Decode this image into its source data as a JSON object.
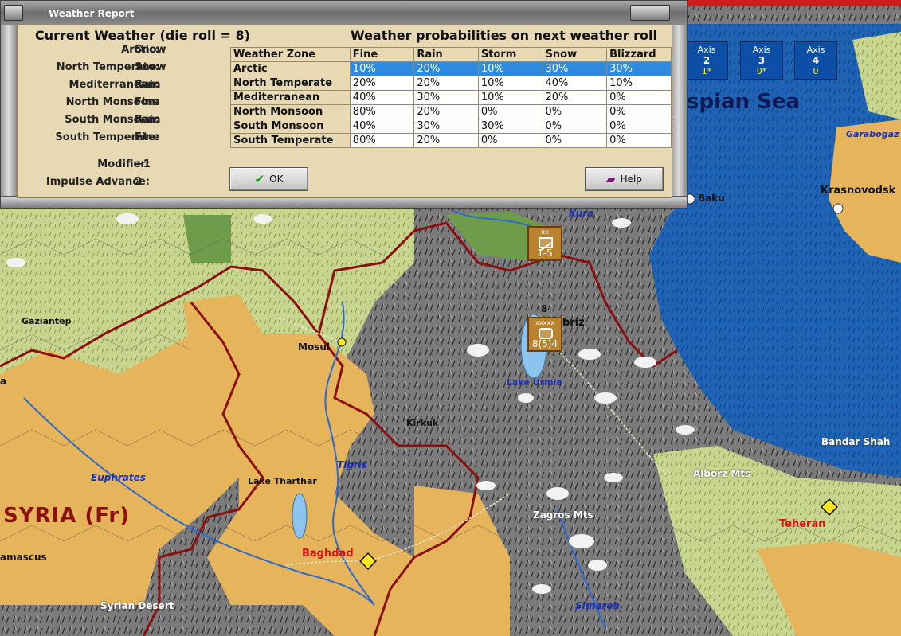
{
  "dialog": {
    "title": "Weather Report",
    "current_heading": "Current Weather (die roll = 8)",
    "prob_heading": "Weather probabilities on next weather roll",
    "current": [
      {
        "zone": "Arctic:",
        "weather": "Snow"
      },
      {
        "zone": "North Temperate:",
        "weather": "Snow"
      },
      {
        "zone": "Mediterranean:",
        "weather": "Rain"
      },
      {
        "zone": "North Monsoon:",
        "weather": "Fine"
      },
      {
        "zone": "South Monsoon:",
        "weather": "Rain"
      },
      {
        "zone": "South Temperate:",
        "weather": "Fine"
      }
    ],
    "modifier_label": "Modifier:",
    "modifier_value": "+1",
    "impulse_label": "Impulse Advance:",
    "impulse_value": "2",
    "table": {
      "headers": [
        "Weather Zone",
        "Fine",
        "Rain",
        "Storm",
        "Snow",
        "Blizzard"
      ],
      "rows": [
        [
          "Arctic",
          "10%",
          "20%",
          "10%",
          "30%",
          "30%"
        ],
        [
          "North Temperate",
          "20%",
          "20%",
          "10%",
          "40%",
          "10%"
        ],
        [
          "Mediterranean",
          "40%",
          "30%",
          "10%",
          "20%",
          "0%"
        ],
        [
          "North Monsoon",
          "80%",
          "20%",
          "0%",
          "0%",
          "0%"
        ],
        [
          "South Monsoon",
          "40%",
          "30%",
          "30%",
          "0%",
          "0%"
        ],
        [
          "South Temperate",
          "80%",
          "20%",
          "0%",
          "0%",
          "0%"
        ]
      ],
      "selected_row": 0
    },
    "ok_label": "OK",
    "help_label": "Help"
  },
  "axis_boxes": [
    {
      "label": "Axis",
      "num": "2",
      "val": "1*"
    },
    {
      "label": "Axis",
      "num": "3",
      "val": "0*"
    },
    {
      "label": "Axis",
      "num": "4",
      "val": "0"
    }
  ],
  "map_labels": {
    "caspian": "spian Sea",
    "garabogaz": "Garabogaz",
    "krasnovodsk": "Krasnovodsk",
    "baku": "Baku",
    "kura": "Kura",
    "gaziantep": "Gaziantep",
    "mosul": "Mosul",
    "kirkuk": "Kirkuk",
    "tabriz": "briz",
    "lake_urmia": "Lake Urmia",
    "bandar_shah": "Bandar Shah",
    "alborz": "Alborz Mts",
    "zagros": "Zagros Mts",
    "teheran": "Teheran",
    "euphrates": "Euphrates",
    "tigris": "Tigris",
    "lake_tharthar": "Lake Tharthar",
    "syria": "SYRIA (Fr)",
    "baghdad": "Baghdad",
    "damascus": "amascus",
    "syrian_desert": "Syrian Desert",
    "simareh": "Simareh",
    "edge_a": "a"
  },
  "counters": {
    "c1_top": "xx",
    "c1_val": "1-5",
    "c2_top": "xxxxx",
    "c2_val": "8(5)4",
    "c2_stack": "8"
  },
  "colors": {
    "desert": "#e6b45a",
    "clear": "#c9d58f",
    "mountain": "#7d7d7d",
    "forest": "#6f9c4a",
    "sea": "#1e5fb0",
    "border": "#8c0f0f",
    "selection": "#2f8bde"
  }
}
